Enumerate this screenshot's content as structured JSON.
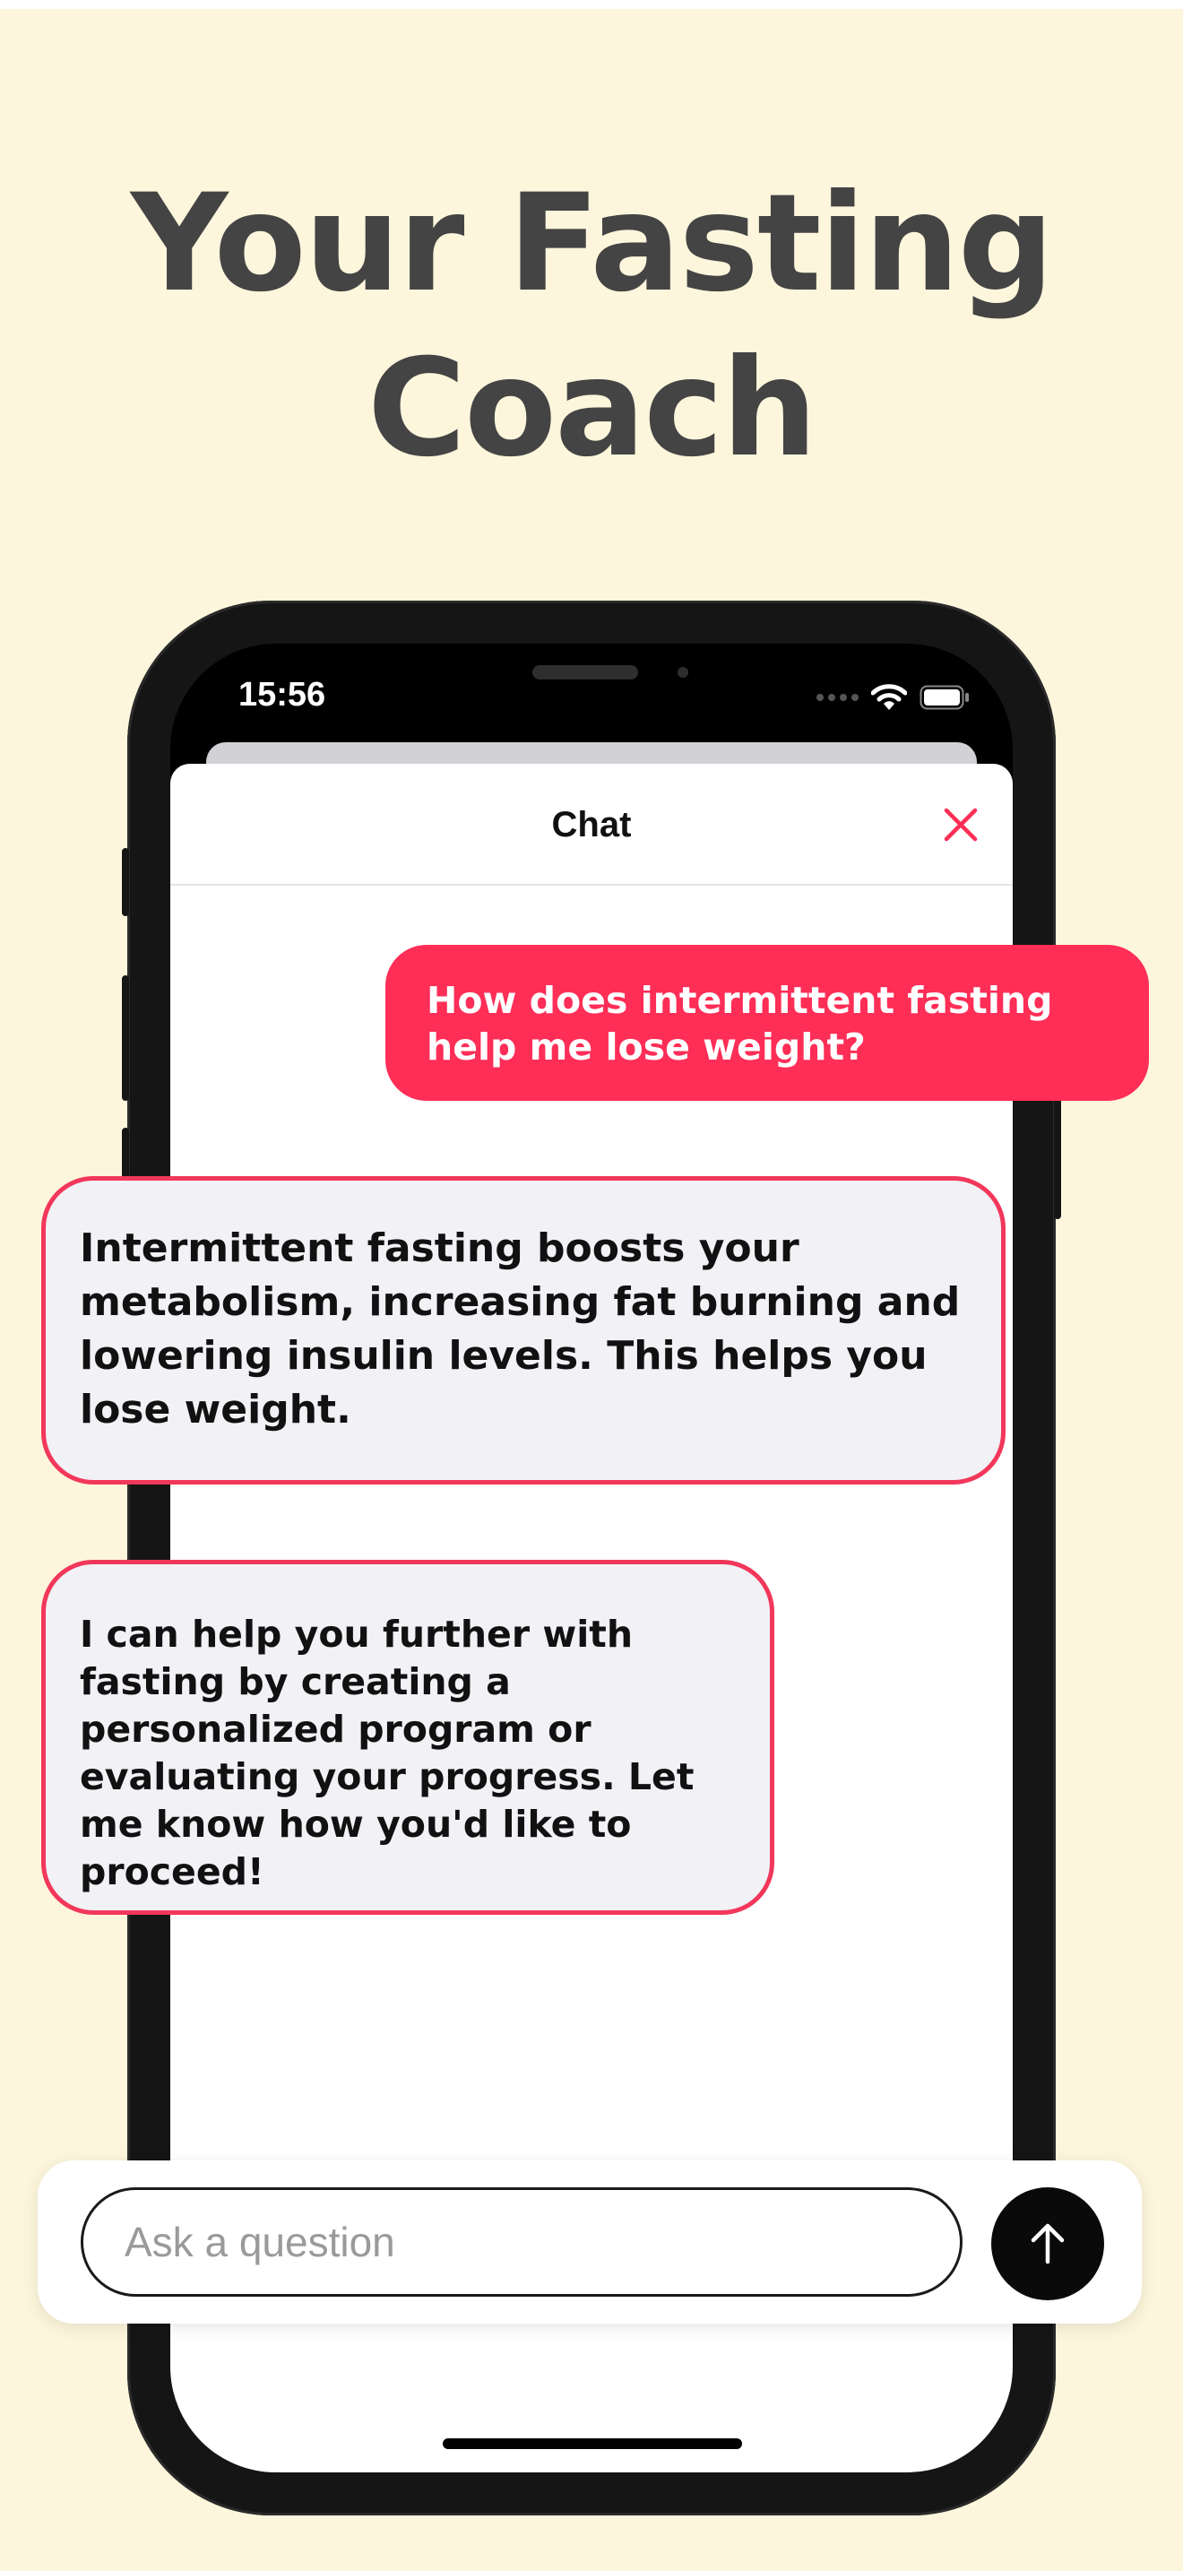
{
  "headline": {
    "line1": "Your Fasting",
    "line2": "Coach"
  },
  "status_bar": {
    "time": "15:56"
  },
  "chat_sheet": {
    "title": "Chat"
  },
  "messages": [
    {
      "role": "user",
      "text": "How does intermittent fasting help me lose weight?"
    },
    {
      "role": "assistant",
      "text": "Intermittent fasting boosts your metabolism, increasing fat burning and lowering insulin levels. This helps you lose weight."
    },
    {
      "role": "assistant",
      "text": "I can help you further with fasting by creating a personalized program or evaluating your progress. Let me know how you'd like to proceed!"
    }
  ],
  "composer": {
    "placeholder": "Ask a question"
  },
  "icons": {
    "close": "close-icon",
    "send": "arrow-up-icon",
    "wifi": "wifi-icon",
    "battery": "battery-icon",
    "signal": "signal-dots-icon"
  },
  "colors": {
    "background": "#fdf6dc",
    "accent": "#fe2e57",
    "bubble_border": "#f2375a",
    "bot_bubble": "#f1f1f6",
    "headline": "#444444"
  }
}
